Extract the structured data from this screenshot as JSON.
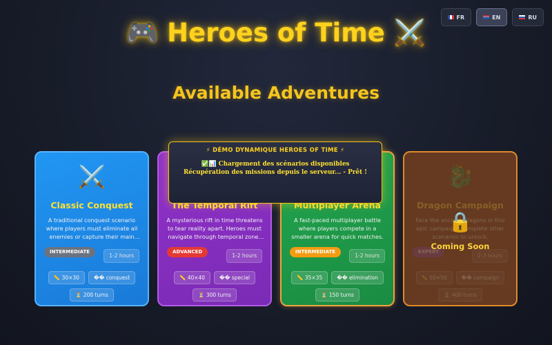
{
  "languages": [
    {
      "flag": "fr",
      "label": "FR",
      "active": false
    },
    {
      "flag": "en",
      "label": "EN",
      "active": true
    },
    {
      "flag": "ru",
      "label": "RU",
      "active": false
    }
  ],
  "header": {
    "title": "🎮 Heroes of Time ⚔️"
  },
  "section": {
    "title": "Available Adventures"
  },
  "difficulty_colors": {
    "INTERMEDIATE_blue": "#6b7280",
    "ADVANCED": "#e53935",
    "INTERMEDIATE_green": "#f39c12",
    "EXPERT": "#7b3fb3"
  },
  "scenarios": [
    {
      "icon": "⚔️",
      "title": "Classic Conquest",
      "description": "A traditional conquest scenario where players must eliminate all enemies or capture their main objectives.",
      "difficulty": "INTERMEDIATE",
      "duration": "1-2 hours",
      "tags": [
        "📏 30×30",
        "�� conquest",
        "⏳ 200 turns"
      ]
    },
    {
      "icon": "🌀",
      "title": "The Temporal Rift",
      "description": "A mysterious rift in time threatens to tear reality apart. Heroes must navigate through temporal zones to seal it.",
      "difficulty": "ADVANCED",
      "duration": "1-2 hours",
      "tags": [
        "📏 40×40",
        "�� special",
        "⏳ 300 turns"
      ]
    },
    {
      "icon": "🏟️",
      "title": "Multiplayer Arena",
      "description": "A fast-paced multiplayer battle where players compete in a smaller arena for quick matches.",
      "difficulty": "INTERMEDIATE",
      "duration": "1-2 hours",
      "tags": [
        "📏 35×35",
        "�� elimination",
        "⏳ 150 turns"
      ]
    },
    {
      "icon": "🐉",
      "title": "Dragon Campaign",
      "description": "Face the ancient dragons in this epic campaign. Complete other scenarios to unlock.",
      "difficulty": "EXPERT",
      "duration": "2-3 hours",
      "tags": [
        "📏 50×50",
        "�� campaign",
        "⏳ 400 turns"
      ],
      "locked": true,
      "lock_icon": "🔒",
      "lock_label": "Coming Soon"
    }
  ],
  "demo_popup": {
    "title": "⚡ DÉMO DYNAMIQUE HEROES OF TIME ⚡",
    "message": "✅📊 Chargement des scénarios disponibles Récupération des missions depuis le serveur... - Prêt !"
  }
}
